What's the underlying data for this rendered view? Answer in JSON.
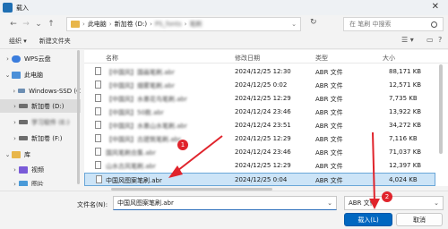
{
  "window": {
    "title": "载入"
  },
  "address": {
    "segments": [
      "此电脑",
      "新加卷 (D:)",
      "PS_fonts",
      "笔刷"
    ],
    "refresh_icon": "refresh-icon"
  },
  "search": {
    "placeholder": "在 笔刷 中搜索"
  },
  "toolbar": {
    "organize": "组织 ▾",
    "new_folder": "新建文件夹"
  },
  "sidebar": {
    "items": [
      {
        "label": "WPS云盘",
        "icon": "cloud-icon",
        "chevron": "›",
        "color": "#3b7ddd"
      },
      {
        "label": "此电脑",
        "icon": "pc-icon",
        "chevron": "⌄",
        "color": "#4a8fd8"
      },
      {
        "label": "Windows-SSD (C",
        "icon": "drive-icon",
        "chevron": "›",
        "color": "#6d8fb3"
      },
      {
        "label": "新加卷 (D:)",
        "icon": "drive-icon",
        "chevron": "›",
        "color": "#6d6d6d",
        "selected": true
      },
      {
        "label": "学习软件 (E:)",
        "icon": "drive-icon",
        "chevron": "›",
        "color": "#6d6d6d"
      },
      {
        "label": "新加卷 (F:)",
        "icon": "drive-icon",
        "chevron": "›",
        "color": "#6d6d6d"
      },
      {
        "label": "库",
        "icon": "library-icon",
        "chevron": "⌄",
        "color": "#e8b64a"
      },
      {
        "label": "视频",
        "icon": "video-icon",
        "chevron": "›",
        "color": "#7a5bd8"
      },
      {
        "label": "图片",
        "icon": "picture-icon",
        "chevron": "›",
        "color": "#4a9ad8"
      }
    ]
  },
  "columns": {
    "name": "名称",
    "date": "修改日期",
    "type": "类型",
    "size": "大小"
  },
  "files": [
    {
      "name": "【中国风】国画笔刷.abr",
      "date": "2024/12/25 12:30",
      "type": "ABR 文件",
      "size": "88,171 KB"
    },
    {
      "name": "【中国风】烟雾笔刷.abr",
      "date": "2024/12/25 0:02",
      "type": "ABR 文件",
      "size": "12,571 KB"
    },
    {
      "name": "【中国风】水墨花鸟笔刷.abr",
      "date": "2024/12/25 12:29",
      "type": "ABR 文件",
      "size": "7,735 KB"
    },
    {
      "name": "【中国风】50款.abr",
      "date": "2024/12/24 23:46",
      "type": "ABR 文件",
      "size": "13,922 KB"
    },
    {
      "name": "【中国风】水墨山水笔刷.abr",
      "date": "2024/12/24 23:51",
      "type": "ABR 文件",
      "size": "34,272 KB"
    },
    {
      "name": "【中国风】古建筑笔刷.abr",
      "date": "2024/12/25 12:29",
      "type": "ABR 文件",
      "size": "7,116 KB"
    },
    {
      "name": "国风笔刷合集.abr",
      "date": "2024/12/24 23:46",
      "type": "ABR 文件",
      "size": "71,037 KB"
    },
    {
      "name": "山水古风笔刷.abr",
      "date": "2024/12/25 12:29",
      "type": "ABR 文件",
      "size": "12,397 KB"
    },
    {
      "name": "中国风图案笔刷.abr",
      "date": "2024/12/25 0:04",
      "type": "ABR 文件",
      "size": "4,024 KB",
      "selected": true
    }
  ],
  "bottom": {
    "filename_label": "文件名(N):",
    "filename_value": "中国风图案笔刷.abr",
    "filetype_value": "ABR 文件",
    "open_label": "载入(L)",
    "cancel_label": "取消"
  },
  "annotations": {
    "badge_1": "1",
    "badge_2": "2"
  },
  "colors": {
    "accent": "#0067c0",
    "arrow": "#e0242c",
    "selection": "#cce4f7"
  }
}
